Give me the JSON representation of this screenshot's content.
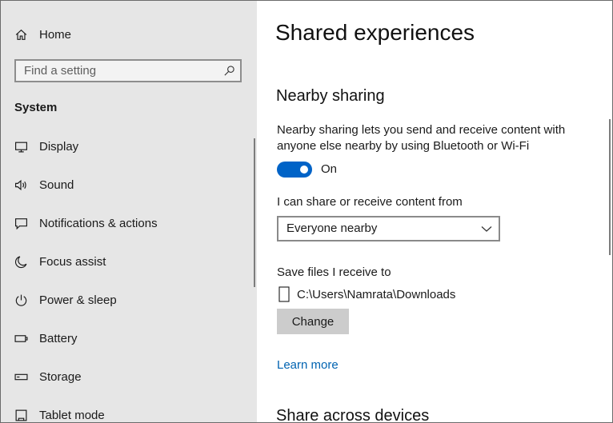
{
  "sidebar": {
    "home_label": "Home",
    "search_placeholder": "Find a setting",
    "section_header": "System",
    "items": [
      {
        "label": "Display",
        "icon": "display-icon"
      },
      {
        "label": "Sound",
        "icon": "sound-icon"
      },
      {
        "label": "Notifications & actions",
        "icon": "notifications-icon"
      },
      {
        "label": "Focus assist",
        "icon": "moon-icon"
      },
      {
        "label": "Power & sleep",
        "icon": "power-icon"
      },
      {
        "label": "Battery",
        "icon": "battery-icon"
      },
      {
        "label": "Storage",
        "icon": "storage-icon"
      },
      {
        "label": "Tablet mode",
        "icon": "tablet-icon"
      }
    ]
  },
  "main": {
    "title": "Shared experiences",
    "nearby": {
      "heading": "Nearby sharing",
      "description": "Nearby sharing lets you send and receive content with anyone else nearby by using Bluetooth or Wi-Fi",
      "toggle_state": "On",
      "toggle_on": true,
      "share_from_label": "I can share or receive content from",
      "share_from_value": "Everyone nearby",
      "save_label": "Save files I receive to",
      "save_path": "C:\\Users\\Namrata\\Downloads",
      "change_button": "Change",
      "learn_more": "Learn more"
    },
    "across_heading": "Share across devices"
  },
  "colors": {
    "accent": "#0063c7",
    "link": "#0063b1",
    "sidebar_bg": "#e6e6e6"
  }
}
